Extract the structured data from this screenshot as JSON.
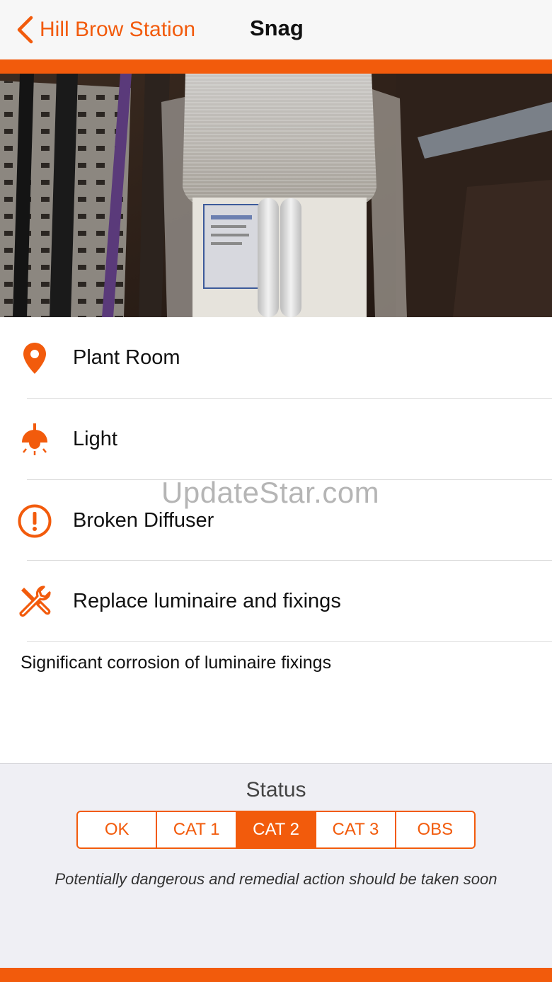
{
  "nav": {
    "back_label": "Hill Brow Station",
    "title": "Snag"
  },
  "photo": {
    "icon": "luminaire-photo"
  },
  "details": {
    "location": {
      "icon": "location-pin-icon",
      "label": "Plant Room"
    },
    "asset": {
      "icon": "ceiling-light-icon",
      "label": "Light"
    },
    "issue": {
      "icon": "exclamation-circle-icon",
      "label": "Broken Diffuser"
    },
    "action": {
      "icon": "tools-icon",
      "label": "Replace luminaire and fixings"
    },
    "description": "Significant corrosion of luminaire fixings"
  },
  "watermark": "UpdateStar.com",
  "status": {
    "title": "Status",
    "options": [
      "OK",
      "CAT 1",
      "CAT 2",
      "CAT 3",
      "OBS"
    ],
    "selected": "CAT 2",
    "description": "Potentially dangerous and remedial action should be taken soon"
  },
  "colors": {
    "accent": "#f25b0c",
    "background": "#ffffff",
    "panel": "#efeff4"
  }
}
